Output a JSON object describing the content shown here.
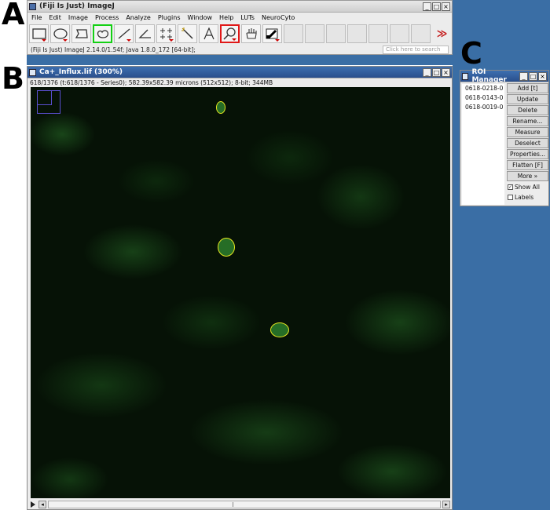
{
  "panels": {
    "a": "A",
    "b": "B",
    "c": "C"
  },
  "imagej": {
    "title": "(Fiji Is Just) ImageJ",
    "menu": [
      "File",
      "Edit",
      "Image",
      "Process",
      "Analyze",
      "Plugins",
      "Window",
      "Help",
      "LUTs",
      "NeuroCyto"
    ],
    "status": "(Fiji Is Just) ImageJ 2.14.0/1.54f; Java 1.8.0_172 [64-bit];",
    "search_placeholder": "Click here to search",
    "tools": [
      {
        "name": "rectangle-tool",
        "icon": "rectangle-icon",
        "highlight": ""
      },
      {
        "name": "oval-tool",
        "icon": "oval-icon",
        "highlight": ""
      },
      {
        "name": "polygon-tool",
        "icon": "polygon-icon",
        "highlight": ""
      },
      {
        "name": "freehand-tool",
        "icon": "freehand-icon",
        "highlight": "green"
      },
      {
        "name": "line-tool",
        "icon": "line-icon",
        "highlight": ""
      },
      {
        "name": "angle-tool",
        "icon": "angle-icon",
        "highlight": ""
      },
      {
        "name": "multipoint-tool",
        "icon": "multipoint-icon",
        "highlight": ""
      },
      {
        "name": "wand-tool",
        "icon": "wand-icon",
        "highlight": ""
      },
      {
        "name": "text-tool",
        "icon": "text-icon",
        "highlight": ""
      },
      {
        "name": "magnifier-tool",
        "icon": "magnifier-icon",
        "highlight": "red"
      },
      {
        "name": "hand-tool",
        "icon": "hand-icon",
        "highlight": ""
      },
      {
        "name": "color-picker-tool",
        "icon": "dropper-icon",
        "highlight": ""
      }
    ],
    "more_tools": "≫"
  },
  "image_window": {
    "title": "Ca+_Influx.lif (300%)",
    "info": "618/1376 (t:618/1376 - Series0); 582.39x582.39 microns (512x512); 8-bit; 344MB"
  },
  "roi_manager": {
    "title": "ROI Manager",
    "items": [
      "0618-0218-0",
      "0618-0143-0",
      "0618-0019-0"
    ],
    "buttons": [
      "Add [t]",
      "Update",
      "Delete",
      "Rename...",
      "Measure",
      "Deselect",
      "Properties...",
      "Flatten [F]",
      "More »"
    ],
    "show_all": "Show All",
    "labels": "Labels"
  },
  "colors": {
    "green_highlight": "#14d014",
    "red_highlight": "#e01818",
    "roi_outline": "#e8e820",
    "desktop_blue": "#3a6ea5"
  }
}
